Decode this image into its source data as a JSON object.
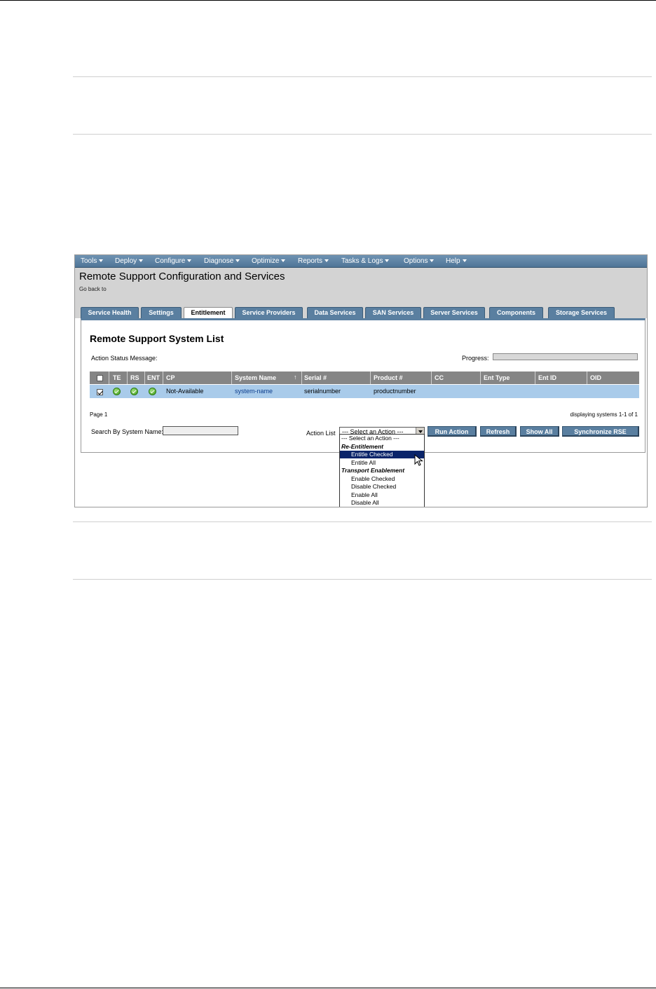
{
  "menu": [
    "Tools",
    "Deploy",
    "Configure",
    "Diagnose",
    "Optimize",
    "Reports",
    "Tasks & Logs",
    "Options",
    "Help"
  ],
  "header": {
    "title": "Remote Support Configuration and Services",
    "go_back": "Go back to"
  },
  "tabs": [
    {
      "label": "Service Health",
      "active": false
    },
    {
      "label": "Settings",
      "active": false
    },
    {
      "label": "Entitlement",
      "active": true
    },
    {
      "label": "Service Providers",
      "active": false
    },
    {
      "label": "Data Services",
      "active": false
    },
    {
      "label": "SAN Services",
      "active": false
    },
    {
      "label": "Server Services",
      "active": false
    },
    {
      "label": "Components",
      "active": false
    },
    {
      "label": "Storage Services",
      "active": false
    }
  ],
  "panel": {
    "title": "Remote Support System List",
    "action_status_label": "Action Status Message:",
    "progress_label": "Progress:"
  },
  "table": {
    "columns": [
      "TE",
      "RS",
      "ENT",
      "CP",
      "System Name",
      "Serial #",
      "Product #",
      "CC",
      "Ent Type",
      "Ent ID",
      "OID"
    ],
    "sort_indicator": "↑",
    "rows": [
      {
        "checked": true,
        "te": "ok",
        "rs": "ok",
        "ent": "ok",
        "cp": "Not-Available",
        "system_name": "system-name",
        "serial": "serialnumber",
        "product": "productnumber",
        "cc": "",
        "ent_type": "",
        "ent_id": "",
        "oid": ""
      }
    ]
  },
  "pager": {
    "page": "Page 1",
    "displaying": "displaying systems 1-1 of 1"
  },
  "search": {
    "label": "Search By System Name:",
    "value": ""
  },
  "actions": {
    "label": "Action List",
    "selected": "--- Select an Action ---",
    "buttons": [
      "Run Action",
      "Refresh",
      "Show All",
      "Synchronize RSE"
    ],
    "dropdown": [
      {
        "label": "--- Select an Action ---",
        "kind": "option-first"
      },
      {
        "label": "Re-Entitlement",
        "kind": "group"
      },
      {
        "label": "Entitle Checked",
        "kind": "option",
        "highlighted": true
      },
      {
        "label": "Entitle All",
        "kind": "option"
      },
      {
        "label": "Transport Enablement",
        "kind": "group"
      },
      {
        "label": "Enable Checked",
        "kind": "option"
      },
      {
        "label": "Disable Checked",
        "kind": "option"
      },
      {
        "label": "Enable All",
        "kind": "option"
      },
      {
        "label": "Disable All",
        "kind": "option"
      }
    ]
  },
  "colors": {
    "menubar": "#5a7fa0",
    "row_highlight": "#a9cbea",
    "table_header": "#858585",
    "option_highlight": "#0a246a"
  }
}
